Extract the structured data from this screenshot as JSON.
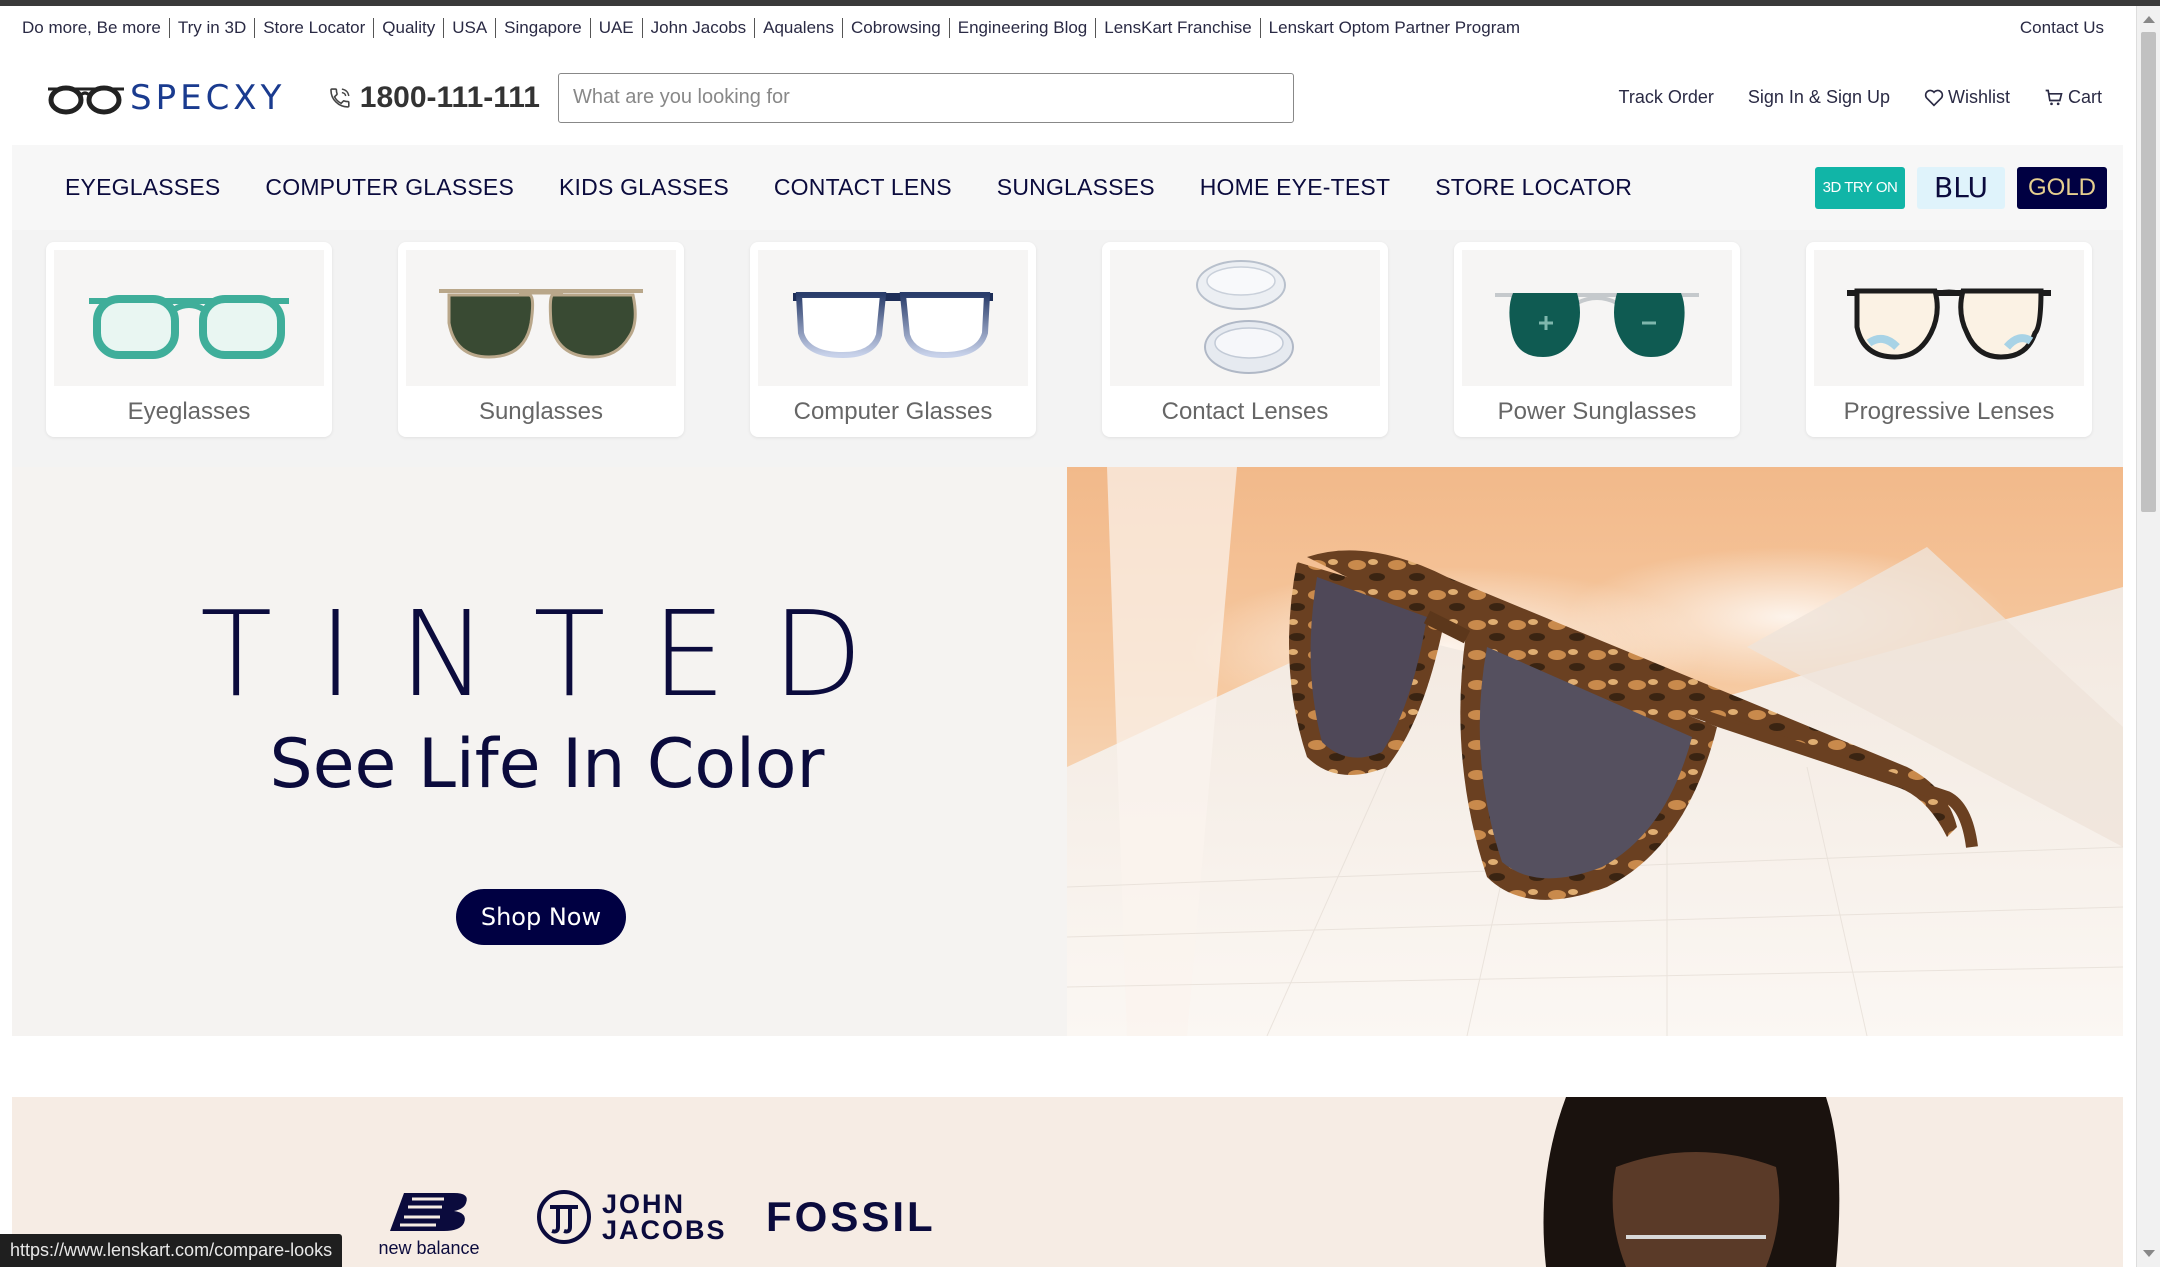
{
  "utility_bar": {
    "links": [
      "Do more, Be more",
      "Try in 3D",
      "Store Locator",
      "Quality",
      "USA",
      "Singapore",
      "UAE",
      "John Jacobs",
      "Aqualens",
      "Cobrowsing",
      "Engineering Blog",
      "LensKart Franchise",
      "Lenskart Optom Partner Program"
    ],
    "contact": "Contact Us"
  },
  "header": {
    "logo_text": "SPECXY",
    "phone": "1800-111-111",
    "search_placeholder": "What are you looking for",
    "search_value": "",
    "actions": {
      "track_order": "Track Order",
      "sign_in": "Sign In & Sign Up",
      "wishlist": "Wishlist",
      "cart": "Cart"
    }
  },
  "nav": {
    "items": [
      "EYEGLASSES",
      "COMPUTER GLASSES",
      "KIDS GLASSES",
      "CONTACT LENS",
      "SUNGLASSES",
      "HOME EYE-TEST",
      "STORE LOCATOR"
    ],
    "badges": {
      "try_on": "3D TRY ON",
      "blu": "BLU",
      "gold": "GOLD"
    }
  },
  "categories": [
    {
      "label": "Eyeglasses",
      "icon": "eyeglasses-icon"
    },
    {
      "label": "Sunglasses",
      "icon": "sunglasses-icon"
    },
    {
      "label": "Computer Glasses",
      "icon": "computer-glasses-icon"
    },
    {
      "label": "Contact Lenses",
      "icon": "contact-lens-icon"
    },
    {
      "label": "Power Sunglasses",
      "icon": "power-sunglasses-icon"
    },
    {
      "label": "Progressive Lenses",
      "icon": "progressive-lenses-icon"
    }
  ],
  "hero": {
    "title": "TINTED",
    "subtitle": "See Life In Color",
    "cta": "Shop Now"
  },
  "brands": {
    "new_balance": "new balance",
    "john_jacobs": "JOHN JACOBS",
    "fossil": "FOSSIL"
  },
  "status_url": "https://www.lenskart.com/compare-looks",
  "colors": {
    "brand_navy": "#000042",
    "teal": "#11b5a7",
    "logo_blue": "#1a3b8f"
  }
}
